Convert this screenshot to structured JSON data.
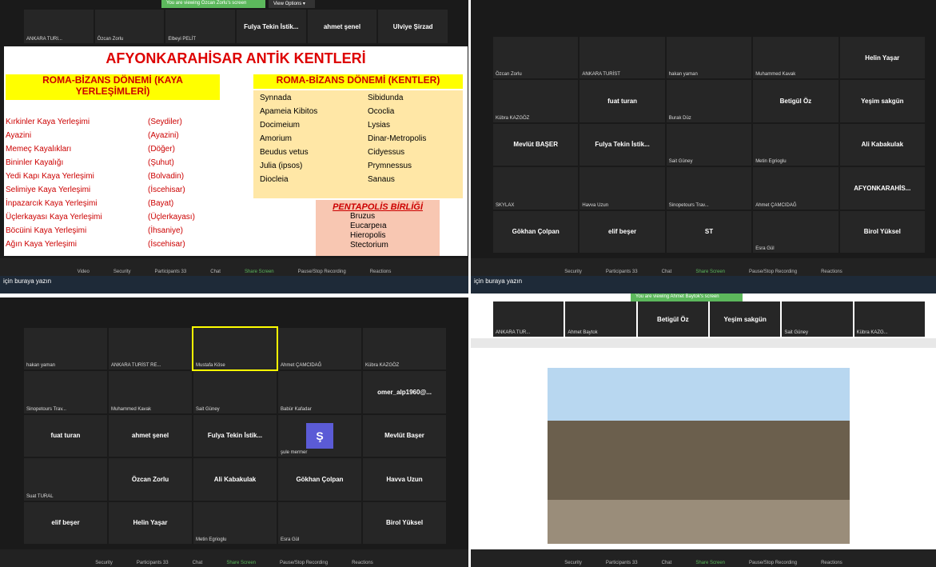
{
  "q1": {
    "banner": "You are viewing Özcan Zorlu's screen",
    "view_options": "View Options ▾",
    "top": [
      "ANKARA TURI...",
      "Özcan Zorlu",
      "Elbeyi PELİT",
      "Fulya Tekin İstik...",
      "ahmet şenel",
      "Ulviye Şirzad"
    ],
    "title": "AFYONKARAHİSAR ANTİK KENTLERİ",
    "left_title": "ROMA-BİZANS DÖNEMİ (KAYA YERLEŞİMLERİ)",
    "right_title": "ROMA-BİZANS DÖNEMİ (KENTLER)",
    "left_items": [
      "Kırkinler Kaya Yerleşimi",
      "Ayazini",
      "Memeç Kayalıkları",
      "Bininler Kayalığı",
      "Yedi Kapı Kaya Yerleşimi",
      "Selimiye Kaya Yerleşimi",
      "İnpazarcık Kaya Yerleşimi",
      "Üçlerkayası Kaya Yerleşimi",
      "Böcüini Kaya Yerleşimi",
      "Ağın Kaya Yerleşimi"
    ],
    "left_places": [
      "(Seydiler)",
      "(Ayazini)",
      "(Döğer)",
      "(Şuhut)",
      "(Bolvadin)",
      "(İscehisar)",
      "(Bayat)",
      "(Üçlerkayası)",
      "(İhsaniye)",
      "(İscehisar)"
    ],
    "cities_a": [
      "Synnada",
      "Apameia Kibitos",
      "Docimeium",
      "Amorium",
      "Beudus vetus",
      "Julia (ipsos)",
      "Diocleia"
    ],
    "cities_b": [
      "Sibidunda",
      "Ococlia",
      "Lysias",
      "Dinar-Metropolis",
      "Cidyessus",
      "Prymnessus",
      "Sanaus"
    ],
    "pentapolis_title": "PENTAPOLİS BİRLİĞİ",
    "pentapolis": [
      "Bruzus",
      "Eucarpeıa",
      "Hieropolis",
      "Stectorium"
    ],
    "toolbar": [
      "Video",
      "Security",
      "Participants 33",
      "Chat",
      "Share Screen",
      "Pause/Stop Recording",
      "Reactions"
    ],
    "taskbar": "için buraya yazın"
  },
  "q2": {
    "cells": [
      "Özcan Zorlu",
      "ANKARA TURİST",
      "hakan yaman",
      "Muhammed Kavak",
      "Helin Yaşar",
      "Kübra KAZGÖZ",
      "fuat turan",
      "Burak Düz",
      "Betigül Öz",
      "Yeşim sakgün",
      "Mevlüt BAŞER",
      "Fulya Tekin İstik...",
      "Sait Güney",
      "Metin Egrioglu",
      "Ali Kabakulak",
      "SKYLAX",
      "Havva Uzun",
      "Sinopetours Trav...",
      "Ahmet ÇAMCIDAĞ",
      "AFYONKARAHİS...",
      "Gökhan Çolpan",
      "elif beşer",
      "ST",
      "Esra Gül",
      "Birol Yüksel"
    ],
    "taskbar": "için buraya yazın"
  },
  "q3": {
    "cells": [
      "hakan yaman",
      "ANKARA TURİST RE...",
      "Mustafa Köse",
      "Ahmet ÇAMCIDAĞ",
      "Kübra KAZGÖZ",
      "Sinopetours Trav...",
      "Muhammed Kavak",
      "Sait Güney",
      "Babür Kafadar",
      "omer_alp1960@...",
      "fuat turan",
      "ahmet şenel",
      "Fulya Tekin İstik...",
      "Ş",
      "Mevlüt Başer",
      "Suat TURAL",
      "Özcan Zorlu",
      "Ali Kabakulak",
      "Gökhan Çolpan",
      "Havva Uzun",
      "elif beşer",
      "Helin Yaşar",
      "Metin Egrioglu",
      "Esra Gül",
      "Birol Yüksel"
    ],
    "extra": "şule mermer"
  },
  "q4": {
    "banner": "You are viewing Ahmet Baytok's screen",
    "top": [
      "ANKARA TUR...",
      "Ahmet Baytok",
      "Betigül Öz",
      "Yeşim sakgün",
      "Sait Güney",
      "Kübra KAZG..."
    ]
  }
}
